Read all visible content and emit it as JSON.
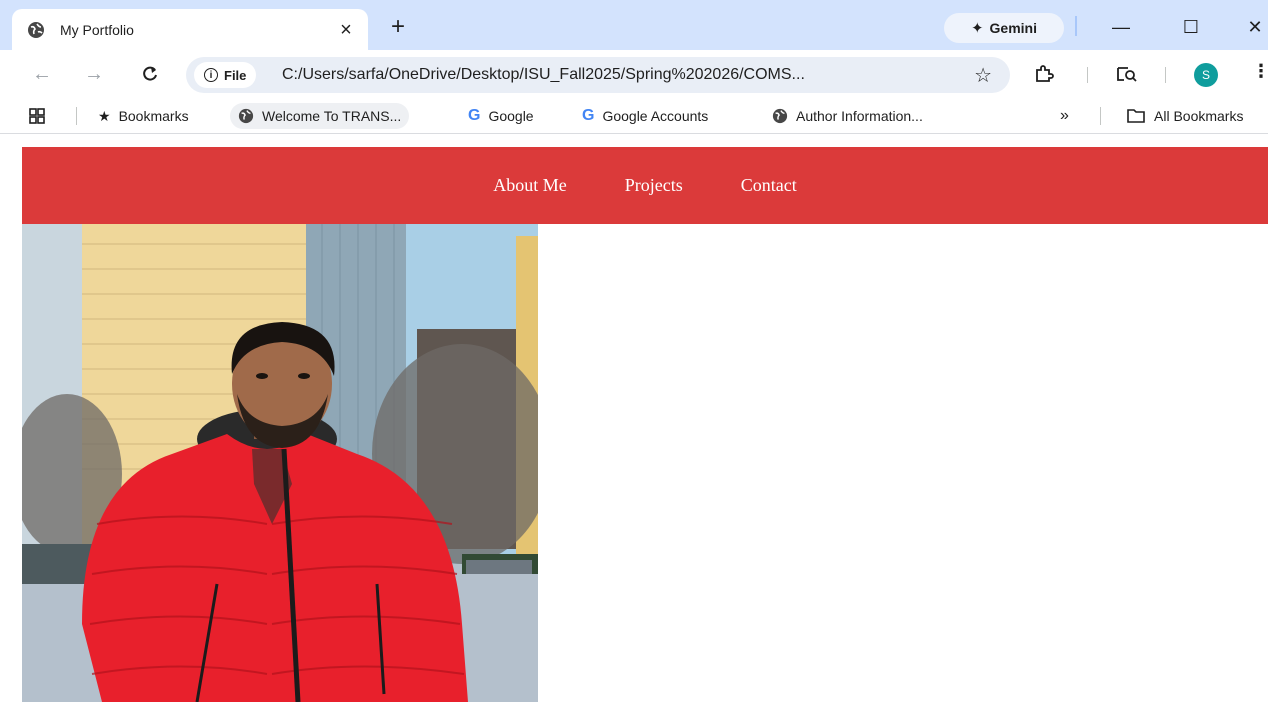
{
  "browser": {
    "tab": {
      "title": "My Portfolio",
      "close_glyph": "×",
      "favicon": "globe-icon"
    },
    "new_tab_glyph": "+",
    "gemini_label": "Gemini",
    "window_controls": {
      "minimize": "—",
      "maximize": "☐",
      "close": "✕"
    },
    "nav": {
      "back": "←",
      "forward": "→",
      "reload": "C"
    },
    "omnibox": {
      "chip_label": "File",
      "url": "C:/Users/sarfa/OneDrive/Desktop/ISU_Fall2025/Spring%202026/COMS..."
    },
    "profile_initial": "S",
    "bookmarks": [
      {
        "label": "Bookmarks",
        "icon": "star-icon"
      },
      {
        "label": "Welcome To TRANS...",
        "icon": "globe-icon"
      },
      {
        "label": "Google",
        "icon": "google-icon"
      },
      {
        "label": "Google Accounts",
        "icon": "google-icon"
      },
      {
        "label": "Author Information...",
        "icon": "globe-icon"
      }
    ],
    "overflow_label": "»",
    "all_bookmarks_label": "All Bookmarks"
  },
  "site": {
    "nav": [
      "About Me",
      "Projects",
      "Contact"
    ]
  },
  "colors": {
    "tabstrip": "#d3e3fd",
    "nav_background": "#db3a3a",
    "jacket": "#e8202c",
    "profile": "#0f9d9d"
  }
}
